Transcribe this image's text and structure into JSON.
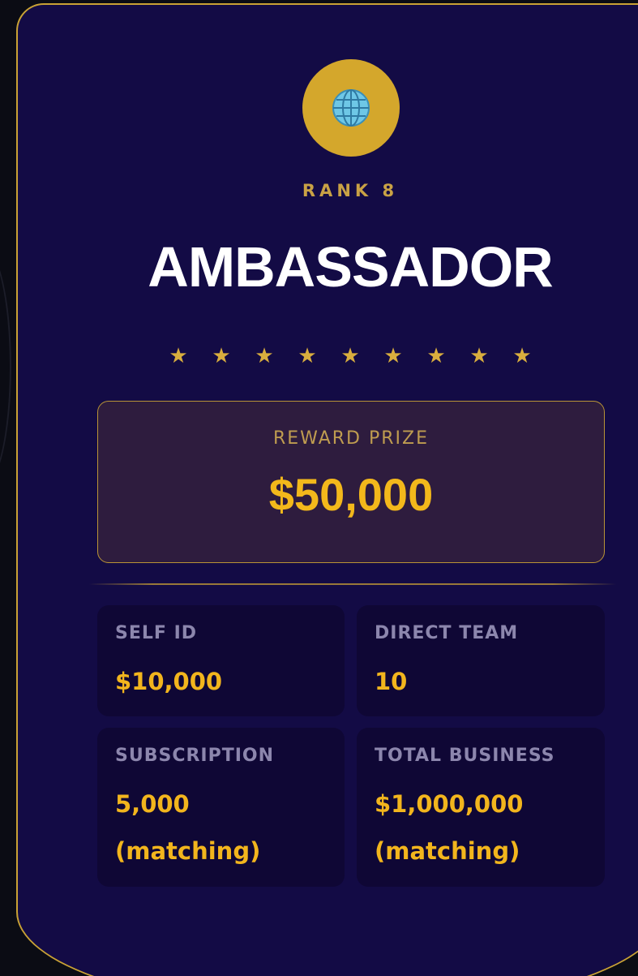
{
  "card": {
    "emblem_icon": "globe-icon",
    "rank_label": "RANK 8",
    "title": "AMBASSADOR",
    "star_count": 9,
    "star_glyph": "★",
    "reward": {
      "label": "REWARD PRIZE",
      "value": "$50,000"
    },
    "stats": [
      {
        "label": "SELF ID",
        "value": "$10,000"
      },
      {
        "label": "DIRECT TEAM",
        "value": "10"
      },
      {
        "label": "SUBSCRIPTION",
        "value": "5,000\n(matching)"
      },
      {
        "label": "TOTAL BUSINESS",
        "value": "$1,000,000\n(matching)"
      }
    ]
  },
  "colors": {
    "card_bg": "#130b45",
    "accent_gold": "#d4a72c",
    "value_gold": "#f2b51d",
    "reward_bg": "#2e1c3e",
    "stat_bg": "#0f0735"
  }
}
